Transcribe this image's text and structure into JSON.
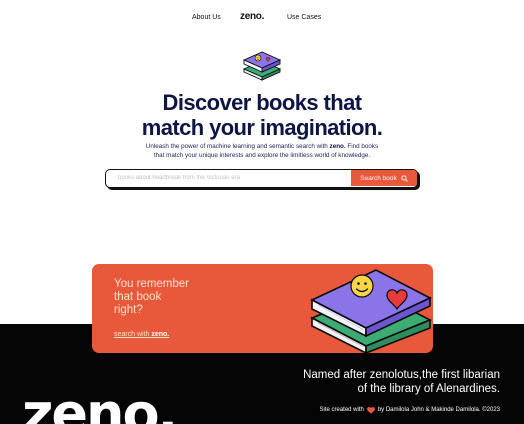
{
  "nav": {
    "about": "About Us",
    "logo": "zeno.",
    "use_cases": "Use Cases"
  },
  "hero": {
    "title_line1": "Discover books that",
    "title_line2": "match your imagination.",
    "subtitle_line1_pre": "Unleash the power of machine learning and semantic search with ",
    "subtitle_brand": "zeno.",
    "subtitle_line1_post": " Find books",
    "subtitle_line2": "that match your unique interests and explore the limitless world of knowledge."
  },
  "search": {
    "placeholder": "books about heartbreak from the Victorian era",
    "button_label": "Search book"
  },
  "promo": {
    "line1": "You remember",
    "line2": "that book",
    "line3": "right?",
    "cta_pre": "search with ",
    "cta_brand": "zeno."
  },
  "footer": {
    "tagline_line1": "Named after zenolotus,the first libarian",
    "tagline_line2": "of the library of Alenardines.",
    "credit_pre": "Site created with",
    "credit_post": "by Damilola John & Makinde Damilola. ©2023",
    "big_logo": "zeno."
  },
  "colors": {
    "accent": "#e8583b",
    "navy": "#0c1544",
    "footer_bg": "#050505",
    "book_purple": "#8b73e8",
    "book_green": "#3dab74",
    "book_cover_cream": "#f6f4ff",
    "smiley_yellow": "#f7d64a",
    "heart_red": "#e83b3b"
  },
  "icons": {
    "search_button": "search-icon",
    "credit": "heart-icon",
    "hero_art": "books-stack-icon",
    "card_art": "books-stack-illustration"
  }
}
